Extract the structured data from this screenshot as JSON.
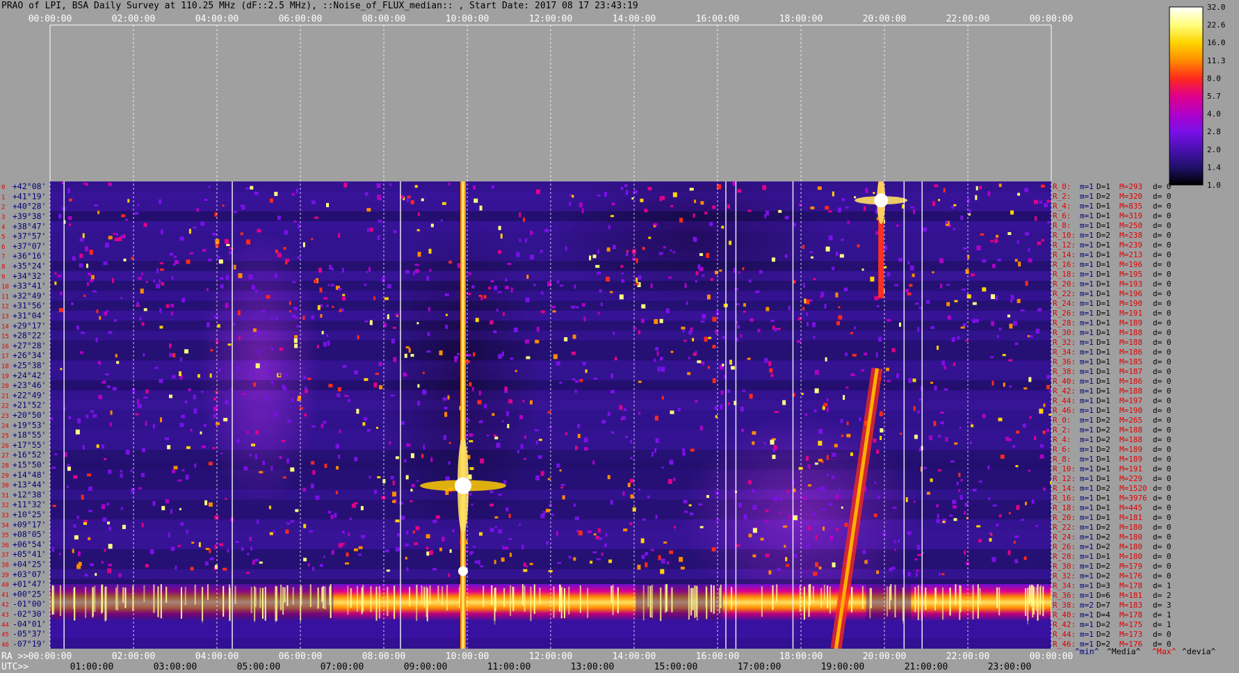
{
  "title": "PRAO of LPI, BSA Daily Survey at 110.25 MHz (dF::2.5 MHz), ::Noise_of_FLUX_median:: , Start Date: 2017 08 17 23:43:19",
  "chart_data": {
    "type": "heatmap",
    "top_axis_ticks": [
      "00:00:00",
      "02:00:00",
      "04:00:00",
      "06:00:00",
      "08:00:00",
      "10:00:00",
      "12:00:00",
      "14:00:00",
      "16:00:00",
      "18:00:00",
      "20:00:00",
      "22:00:00",
      "00:00:00"
    ],
    "ra_axis_label": "RA >>",
    "ra_ticks": [
      "00:00:00",
      "02:00:00",
      "04:00:00",
      "06:00:00",
      "08:00:00",
      "10:00:00",
      "12:00:00",
      "14:00:00",
      "16:00:00",
      "18:00:00",
      "20:00:00",
      "22:00:00",
      "00:00:00"
    ],
    "utc_axis_label": "UTC>>",
    "utc_ticks": [
      "01:00:00",
      "03:00:00",
      "05:00:00",
      "07:00:00",
      "09:00:00",
      "11:00:00",
      "13:00:00",
      "15:00:00",
      "17:00:00",
      "19:00:00",
      "21:00:00",
      "23:00:00"
    ],
    "declinations": [
      "+42°08'",
      "+41°19'",
      "+40°28'",
      "+39°38'",
      "+38°47'",
      "+37°57'",
      "+37°07'",
      "+36°16'",
      "+35°24'",
      "+34°32'",
      "+33°41'",
      "+32°49'",
      "+31°56'",
      "+31°04'",
      "+29°17'",
      "+28°22'",
      "+27°28'",
      "+26°34'",
      "+25°38'",
      "+24°42'",
      "+23°46'",
      "+22°49'",
      "+21°52'",
      "+20°50'",
      "+19°53'",
      "+18°55'",
      "+17°55'",
      "+16°52'",
      "+15°50'",
      "+14°48'",
      "+13°44'",
      "+12°38'",
      "+11°32'",
      "+10°25'",
      "+09°17'",
      "+08°05'",
      "+06°54'",
      "+05°41'",
      "+04°25'",
      "+03°07'",
      "+01°47'",
      "+00°25'",
      "-01°00'",
      "-02°30'",
      "-04°01'",
      "-05°37'",
      "-07°19'"
    ],
    "colorbar": {
      "ticks": [
        "32.0",
        "22.6",
        "16.0",
        "11.3",
        "8.0",
        "5.7",
        "4.0",
        "2.8",
        "2.0",
        "1.4",
        "1.0"
      ],
      "colors": [
        "#ffffff",
        "#ffff80",
        "#ffd400",
        "#ff8c00",
        "#ff2a1a",
        "#e0008a",
        "#b000c8",
        "#7a10e8",
        "#4a10b0",
        "#20106a",
        "#000000"
      ]
    },
    "stats": [
      {
        "r": "R_0:",
        "m": "m=1",
        "d1": "D=1",
        "M": "M=293",
        "d": "d= 0"
      },
      {
        "r": "R_2:",
        "m": "m=1",
        "d1": "D=2",
        "M": "M=320",
        "d": "d= 0"
      },
      {
        "r": "R_4:",
        "m": "m=1",
        "d1": "D=1",
        "M": "M=835",
        "d": "d= 0"
      },
      {
        "r": "R_6:",
        "m": "m=1",
        "d1": "D=1",
        "M": "M=319",
        "d": "d= 0"
      },
      {
        "r": "R_8:",
        "m": "m=1",
        "d1": "D=1",
        "M": "M=250",
        "d": "d= 0"
      },
      {
        "r": "R_10:",
        "m": "m=1",
        "d1": "D=2",
        "M": "M=238",
        "d": "d= 0"
      },
      {
        "r": "R_12:",
        "m": "m=1",
        "d1": "D=1",
        "M": "M=239",
        "d": "d= 0"
      },
      {
        "r": "R_14:",
        "m": "m=1",
        "d1": "D=1",
        "M": "M=213",
        "d": "d= 0"
      },
      {
        "r": "R_16:",
        "m": "m=1",
        "d1": "D=1",
        "M": "M=196",
        "d": "d= 0"
      },
      {
        "r": "R_18:",
        "m": "m=1",
        "d1": "D=1",
        "M": "M=195",
        "d": "d= 0"
      },
      {
        "r": "R_20:",
        "m": "m=1",
        "d1": "D=1",
        "M": "M=193",
        "d": "d= 0"
      },
      {
        "r": "R_22:",
        "m": "m=1",
        "d1": "D=1",
        "M": "M=196",
        "d": "d= 0"
      },
      {
        "r": "R_24:",
        "m": "m=1",
        "d1": "D=1",
        "M": "M=190",
        "d": "d= 0"
      },
      {
        "r": "R_26:",
        "m": "m=1",
        "d1": "D=1",
        "M": "M=191",
        "d": "d= 0"
      },
      {
        "r": "R_28:",
        "m": "m=1",
        "d1": "D=1",
        "M": "M=189",
        "d": "d= 0"
      },
      {
        "r": "R_30:",
        "m": "m=1",
        "d1": "D=1",
        "M": "M=188",
        "d": "d= 0"
      },
      {
        "r": "R_32:",
        "m": "m=1",
        "d1": "D=1",
        "M": "M=188",
        "d": "d= 0"
      },
      {
        "r": "R_34:",
        "m": "m=1",
        "d1": "D=1",
        "M": "M=186",
        "d": "d= 0"
      },
      {
        "r": "R_36:",
        "m": "m=1",
        "d1": "D=1",
        "M": "M=185",
        "d": "d= 0"
      },
      {
        "r": "R_38:",
        "m": "m=1",
        "d1": "D=1",
        "M": "M=187",
        "d": "d= 0"
      },
      {
        "r": "R_40:",
        "m": "m=1",
        "d1": "D=1",
        "M": "M=186",
        "d": "d= 0"
      },
      {
        "r": "R_42:",
        "m": "m=1",
        "d1": "D=1",
        "M": "M=188",
        "d": "d= 0"
      },
      {
        "r": "R_44:",
        "m": "m=1",
        "d1": "D=1",
        "M": "M=197",
        "d": "d= 0"
      },
      {
        "r": "R_46:",
        "m": "m=1",
        "d1": "D=1",
        "M": "M=190",
        "d": "d= 0"
      },
      {
        "r": "R_0:",
        "m": "m=1",
        "d1": "D=2",
        "M": "M=265",
        "d": "d= 0"
      },
      {
        "r": "R_2:",
        "m": "m=1",
        "d1": "D=2",
        "M": "M=188",
        "d": "d= 0"
      },
      {
        "r": "R_4:",
        "m": "m=1",
        "d1": "D=2",
        "M": "M=188",
        "d": "d= 0"
      },
      {
        "r": "R_6:",
        "m": "m=1",
        "d1": "D=2",
        "M": "M=189",
        "d": "d= 0"
      },
      {
        "r": "R_8:",
        "m": "m=1",
        "d1": "D=1",
        "M": "M=189",
        "d": "d= 0"
      },
      {
        "r": "R_10:",
        "m": "m=1",
        "d1": "D=1",
        "M": "M=191",
        "d": "d= 0"
      },
      {
        "r": "R_12:",
        "m": "m=1",
        "d1": "D=1",
        "M": "M=229",
        "d": "d= 0"
      },
      {
        "r": "R_14:",
        "m": "m=1",
        "d1": "D=2",
        "M": "M=1520",
        "d": "d= 0"
      },
      {
        "r": "R_16:",
        "m": "m=1",
        "d1": "D=1",
        "M": "M=3976",
        "d": "d= 0"
      },
      {
        "r": "R_18:",
        "m": "m=1",
        "d1": "D=1",
        "M": "M=445",
        "d": "d= 0"
      },
      {
        "r": "R_20:",
        "m": "m=1",
        "d1": "D=1",
        "M": "M=181",
        "d": "d= 0"
      },
      {
        "r": "R_22:",
        "m": "m=1",
        "d1": "D=2",
        "M": "M=180",
        "d": "d= 0"
      },
      {
        "r": "R_24:",
        "m": "m=1",
        "d1": "D=2",
        "M": "M=180",
        "d": "d= 0"
      },
      {
        "r": "R_26:",
        "m": "m=1",
        "d1": "D=2",
        "M": "M=180",
        "d": "d= 0"
      },
      {
        "r": "R_28:",
        "m": "m=1",
        "d1": "D=1",
        "M": "M=180",
        "d": "d= 0"
      },
      {
        "r": "R_30:",
        "m": "m=1",
        "d1": "D=2",
        "M": "M=179",
        "d": "d= 0"
      },
      {
        "r": "R_32:",
        "m": "m=1",
        "d1": "D=2",
        "M": "M=176",
        "d": "d= 0"
      },
      {
        "r": "R_34:",
        "m": "m=1",
        "d1": "D=3",
        "M": "M=178",
        "d": "d= 1"
      },
      {
        "r": "R_36:",
        "m": "m=1",
        "d1": "D=6",
        "M": "M=181",
        "d": "d= 2"
      },
      {
        "r": "R_38:",
        "m": "m=2",
        "d1": "D=7",
        "M": "M=183",
        "d": "d= 3"
      },
      {
        "r": "R_40:",
        "m": "m=1",
        "d1": "D=4",
        "M": "M=178",
        "d": "d= 1"
      },
      {
        "r": "R_42:",
        "m": "m=1",
        "d1": "D=2",
        "M": "M=175",
        "d": "d= 1"
      },
      {
        "r": "R_44:",
        "m": "m=1",
        "d1": "D=2",
        "M": "M=173",
        "d": "d= 0"
      },
      {
        "r": "R_46:",
        "m": "m=1",
        "d1": "D=2",
        "M": "M=176",
        "d": "d= 0"
      }
    ],
    "stats_legend": [
      "^min^",
      "^Media^",
      "^Max^",
      "^devia^"
    ]
  },
  "colors": {
    "background": "#a0a0a0",
    "label_red": "#e00000",
    "label_blue": "#00007a",
    "plot_dark": "#1a0a40"
  }
}
